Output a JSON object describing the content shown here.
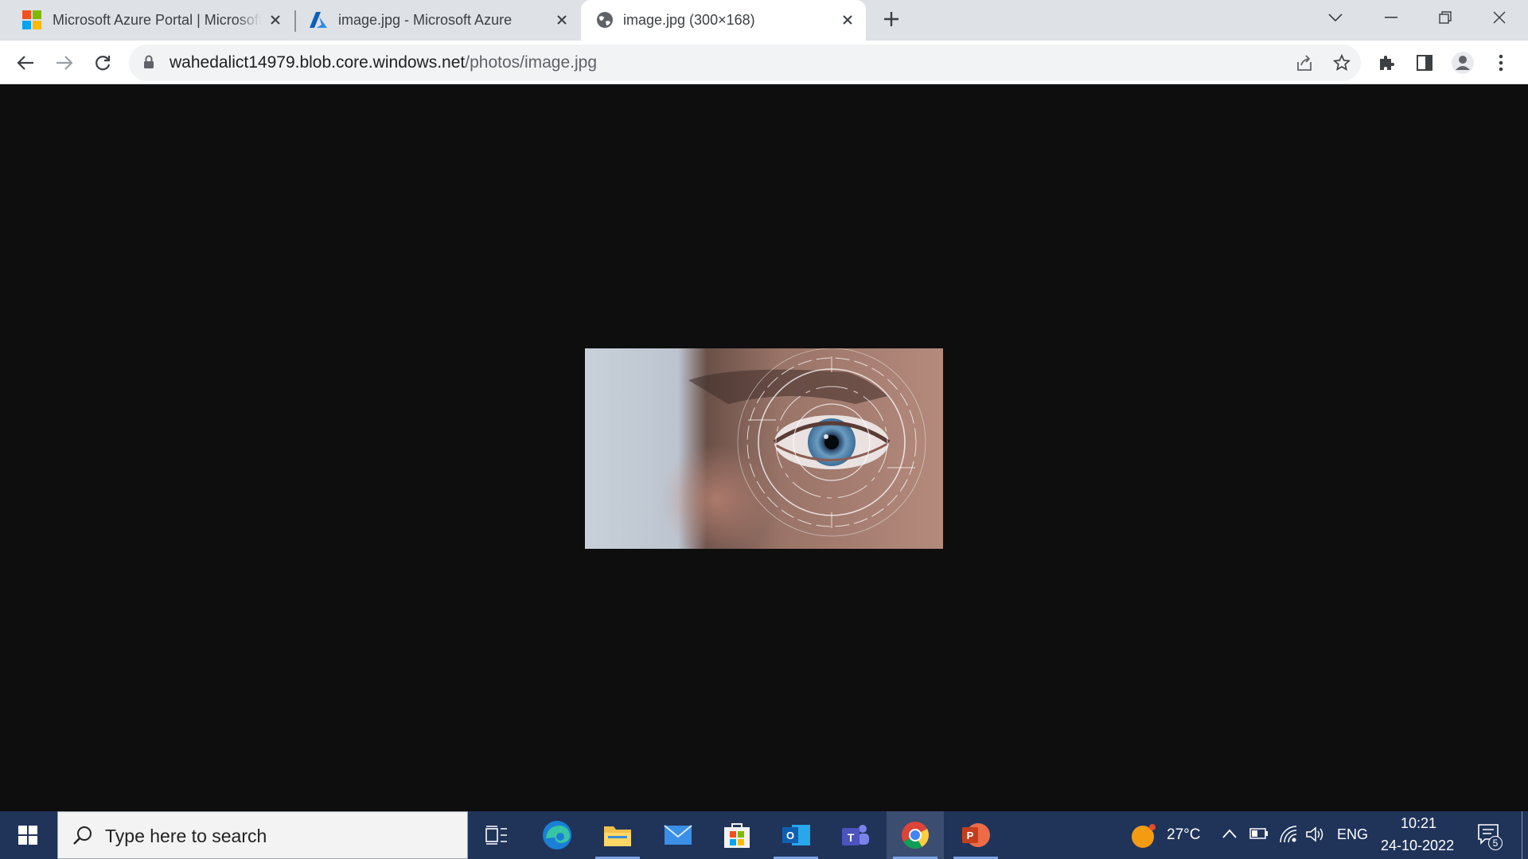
{
  "browser": {
    "tabs": [
      {
        "title": "Microsoft Azure Portal | Microsoft Azure",
        "favicon": "microsoft-logo-icon"
      },
      {
        "title": "image.jpg - Microsoft Azure",
        "favicon": "azure-logo-icon"
      },
      {
        "title": "image.jpg (300×168)",
        "favicon": "globe-icon",
        "active": true
      }
    ],
    "address_bar": {
      "host": "wahedalict14979.blob.core.windows.net",
      "path": "/photos/image.jpg"
    },
    "toolbar_icons": [
      "back-arrow-icon",
      "forward-arrow-icon",
      "reload-icon",
      "lock-icon",
      "share-icon",
      "bookmark-star-icon",
      "extensions-puzzle-icon",
      "side-panel-icon",
      "profile-avatar-icon",
      "menu-kebab-icon"
    ]
  },
  "content": {
    "image_subject": "close-up of human eye with digital scan circles",
    "background_color": "#0e0e0e"
  },
  "taskbar": {
    "search_placeholder": "Type here to search",
    "apps": [
      "task-view-icon",
      "edge-icon",
      "file-explorer-icon",
      "mail-icon",
      "microsoft-store-icon",
      "outlook-icon",
      "teams-icon",
      "chrome-icon",
      "powerpoint-icon"
    ],
    "weather": {
      "temperature": "27°C"
    },
    "language": "ENG",
    "time": "10:21",
    "date": "24-10-2022",
    "notification_count": "5"
  },
  "colors": {
    "taskbar": "#20345a",
    "tabstrip": "#dee1e6",
    "omnibox": "#f1f3f4"
  }
}
